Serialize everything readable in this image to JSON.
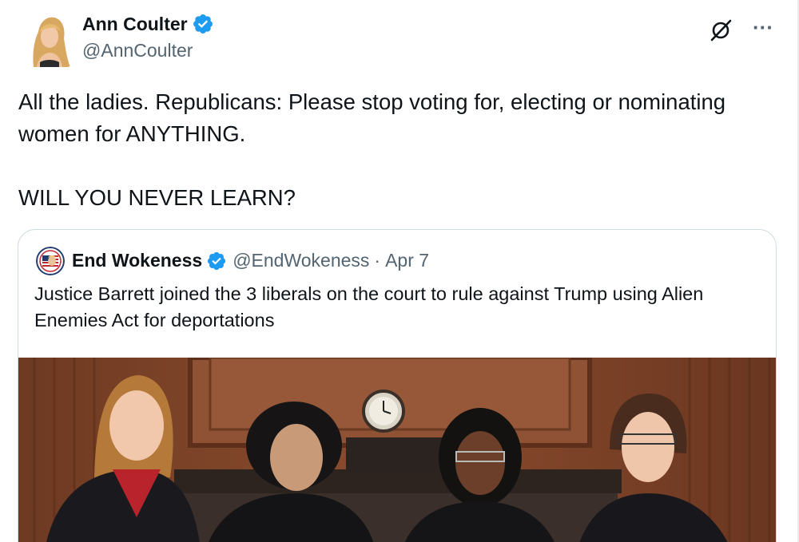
{
  "author": {
    "name": "Ann Coulter",
    "handle": "@AnnCoulter",
    "verified": true
  },
  "tweet": {
    "line1": "All the ladies.  Republicans: Please stop voting for, electing or nominating women for ANYTHING.",
    "line2": "WILL YOU NEVER LEARN?"
  },
  "quoted": {
    "name": "End Wokeness",
    "handle": "@EndWokeness",
    "separator": "·",
    "date": "Apr 7",
    "text": "Justice Barrett joined the 3 liberals on the court to rule against Trump using Alien Enemies Act for deportations",
    "has_photo": true
  },
  "icons": {
    "grok": "grok-icon",
    "more": "more-options-icon",
    "verified": "verified-badge-icon"
  },
  "colors": {
    "verified_blue": "#1d9bf0",
    "secondary_text": "#536471",
    "primary_text": "#0f1419",
    "border": "#cfd9de"
  },
  "more_label": "···"
}
